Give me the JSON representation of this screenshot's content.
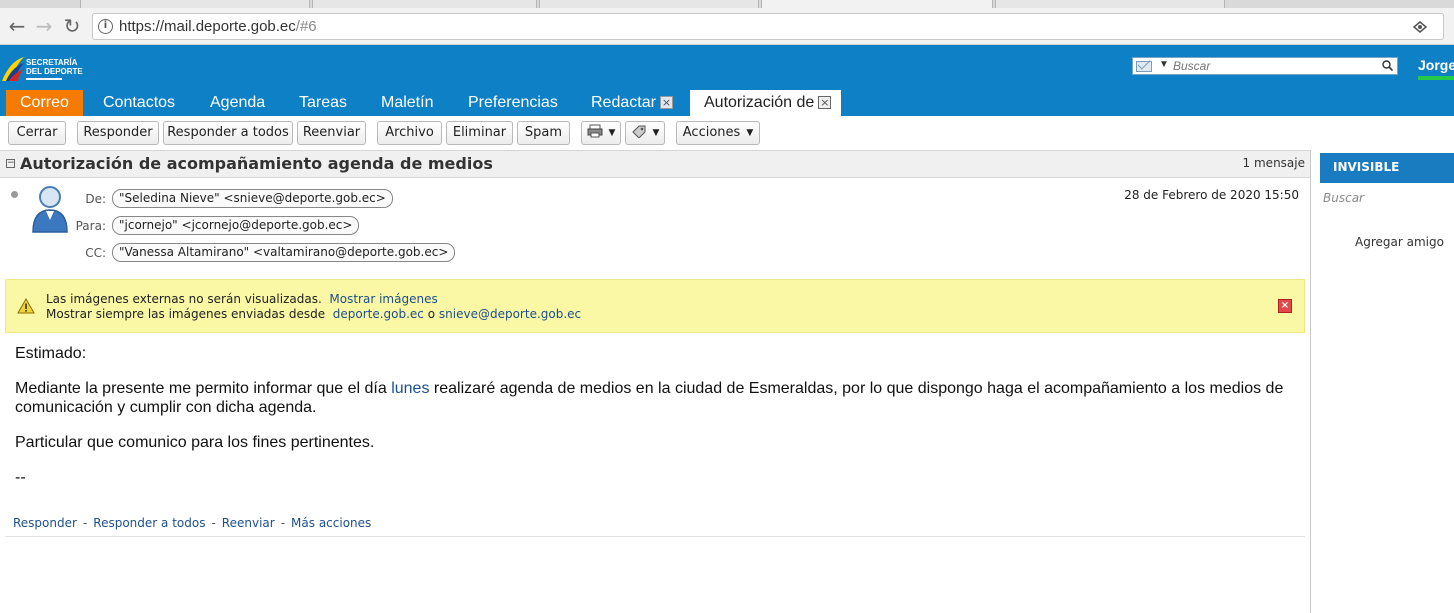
{
  "browser": {
    "url_host": "https://mail.deporte.gob.ec",
    "url_path": "/#6"
  },
  "app": {
    "logo_text_1": "SECRETARÍA",
    "logo_text_2": "DEL DEPORTE",
    "search_placeholder": "Buscar",
    "user_name": "Jorge",
    "tabs": [
      {
        "label": "Correo"
      },
      {
        "label": "Contactos"
      },
      {
        "label": "Agenda"
      },
      {
        "label": "Tareas"
      },
      {
        "label": "Maletín"
      },
      {
        "label": "Preferencias"
      },
      {
        "label": "Redactar"
      },
      {
        "label": "Autorización de"
      }
    ]
  },
  "toolbar": {
    "cerrar": "Cerrar",
    "responder": "Responder",
    "responder_todos": "Responder a todos",
    "reenviar": "Reenviar",
    "archivo": "Archivo",
    "eliminar": "Eliminar",
    "spam": "Spam",
    "acciones": "Acciones"
  },
  "conversation": {
    "subject": "Autorización de acompañamiento agenda de medios",
    "count": "1 mensaje"
  },
  "message": {
    "from_label": "De:",
    "from": "\"Seledina Nieve\" <snieve@deporte.gob.ec>",
    "to_label": "Para:",
    "to": "\"jcornejo\" <jcornejo@deporte.gob.ec>",
    "cc_label": "CC:",
    "cc": "\"Vanessa Altamirano\" <valtamirano@deporte.gob.ec>",
    "date": "28 de Febrero de 2020 15:50"
  },
  "warning": {
    "line1_text": "Las imágenes externas no serán visualizadas.",
    "line1_link": "Mostrar imágenes",
    "line2_text": "Mostrar siempre las imágenes enviadas desde",
    "line2_link1": "deporte.gob.ec",
    "line2_or": "o",
    "line2_link2": "snieve@deporte.gob.ec"
  },
  "body": {
    "greeting": "Estimado:",
    "para1_a": "Mediante la presente me permito informar que el día ",
    "para1_kw": "lunes",
    "para1_b": " realizaré agenda de medios en la ciudad de Esmeraldas, por lo que dispongo haga el acompañamiento a los medios de comunicación y cumplir con dicha agenda.",
    "para2": "Particular que comunico para los fines pertinentes.",
    "signature": "--"
  },
  "footer_links": {
    "responder": "Responder",
    "responder_todos": "Responder a todos",
    "reenviar": "Reenviar",
    "mas_acciones": "Más acciones",
    "sep": "-"
  },
  "chat_panel": {
    "status": "INVISIBLE",
    "search_placeholder": "Buscar",
    "add_friend": "Agregar amigo"
  }
}
